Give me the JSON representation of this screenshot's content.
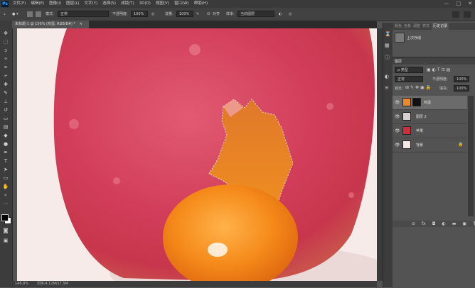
{
  "app": {
    "logo": "Ps"
  },
  "menu": [
    "文件(F)",
    "编辑(E)",
    "图像(I)",
    "图层(L)",
    "文字(Y)",
    "选择(S)",
    "滤镜(T)",
    "3D(D)",
    "视图(V)",
    "窗口(W)",
    "帮助(H)"
  ],
  "window_buttons": [
    "—",
    "□",
    "✕"
  ],
  "options_bar": {
    "mode_label": "模式:",
    "mode_value": "正常",
    "opacity_label": "不透明度:",
    "opacity_value": "100%",
    "flow_label": "流量:",
    "flow_value": "100%",
    "align_label": "对齐",
    "sample_label": "样本:",
    "sample_value": "当前图层"
  },
  "document_tab": {
    "title": "未标题-1 @ 150% (鸡蛋, RGB/8#) *",
    "close": "×"
  },
  "status": {
    "zoom": "146.8%",
    "doc": "文档:4.12M/17.5M"
  },
  "history_panel": {
    "tabs": [
      "颜色",
      "色板",
      "调整",
      "样式",
      "历史记录"
    ],
    "active_tab": "历史记录",
    "entry": "上次存储"
  },
  "layers_panel": {
    "tab": "图层",
    "kind_label": "ρ 类型",
    "blend_mode": "正常",
    "opacity_label": "不透明度:",
    "opacity_value": "100%",
    "lock_label": "锁定:",
    "fill_label": "填充:",
    "fill_value": "100%",
    "layers": [
      {
        "name": "鸡蛋",
        "selected": true,
        "thumb_color": "#e88a2a",
        "has_mask": true
      },
      {
        "name": "图层 2",
        "selected": false,
        "thumb_color": "#d8d0d0",
        "has_mask": false
      },
      {
        "name": "苹果",
        "selected": false,
        "thumb_color": "#c8303c",
        "has_mask": false
      },
      {
        "name": "背景",
        "selected": false,
        "thumb_color": "#f5e8e6",
        "has_mask": false,
        "locked": true
      }
    ],
    "footer_icons": [
      "link-icon",
      "fx-icon",
      "mask-icon",
      "adjustment-icon",
      "folder-icon",
      "new-layer-icon",
      "trash-icon"
    ]
  }
}
